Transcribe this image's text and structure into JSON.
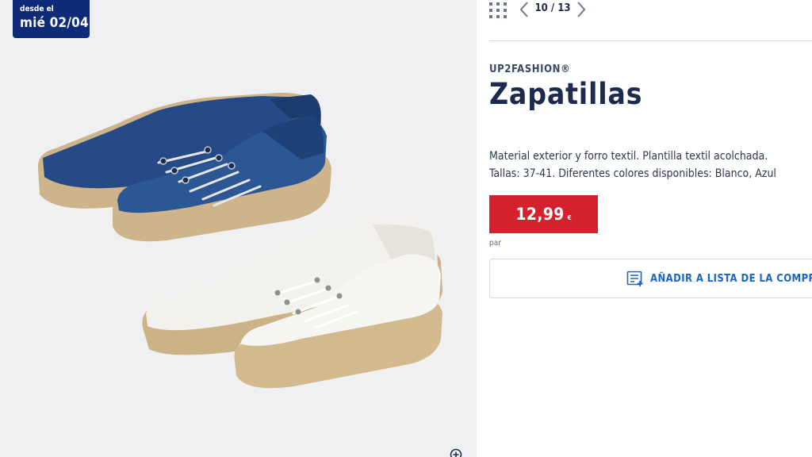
{
  "badge": {
    "line1": "desde el",
    "line2": "mié 02/04"
  },
  "icons": {
    "zoom": "zoom-in-icon",
    "grid": "grid-dots-icon",
    "prev": "chevron-left-icon",
    "next": "chevron-right-icon",
    "list": "add-to-list-icon"
  },
  "nav": {
    "counter": "10 / 13"
  },
  "product": {
    "brand": "UP2FASHION®",
    "title": "Zapatillas",
    "description": [
      "Material exterior y forro textil. Plantilla textil acolchada.",
      "Tallas: 37-41. Diferentes colores disponibles: Blanco, Azul"
    ],
    "price": "12,99",
    "currency": "€",
    "unit": "par"
  },
  "actions": {
    "add_to_list": "AÑADIR A LISTA DE LA COMPRA"
  },
  "colors": {
    "accent": "#1a66c8",
    "price": "#d3212e",
    "badge": "#0f2a77",
    "text": "#1c2a4d"
  }
}
